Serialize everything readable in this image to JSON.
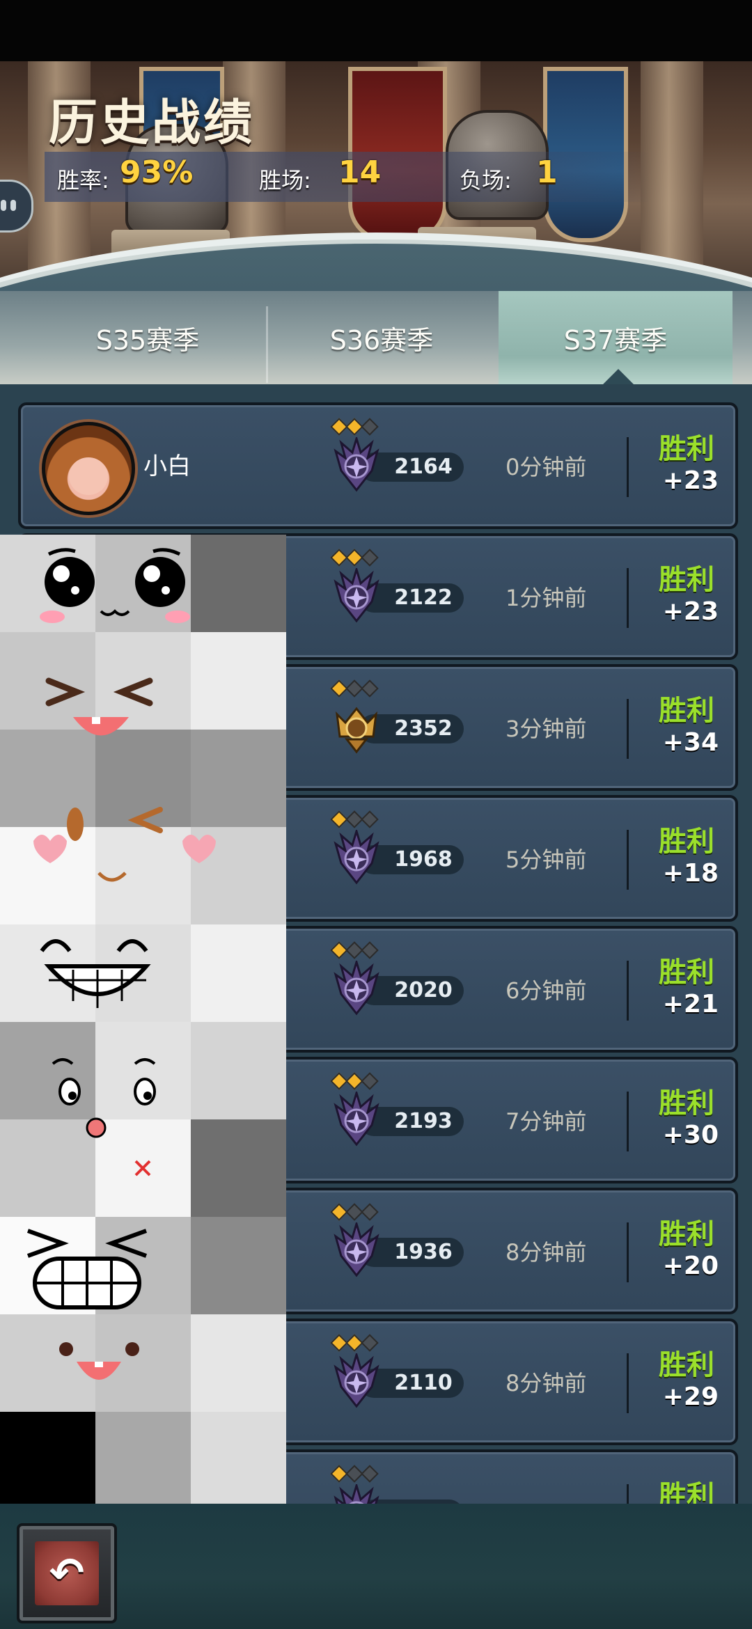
{
  "header": {
    "title": "历史战绩",
    "win_rate_label": "胜率:",
    "win_rate_value": "93%",
    "wins_label": "胜场:",
    "wins_value": "14",
    "losses_label": "负场:",
    "losses_value": "1"
  },
  "tabs": [
    {
      "label": "S35赛季",
      "active": false
    },
    {
      "label": "S36赛季",
      "active": false
    },
    {
      "label": "S37赛季",
      "active": true
    }
  ],
  "records": [
    {
      "name": "小白",
      "stars_lit": 2,
      "rank_badge": "purple-shield-icon",
      "score": "2164",
      "time": "0分钟前",
      "result": "胜利",
      "points": "+23"
    },
    {
      "name": "",
      "stars_lit": 2,
      "rank_badge": "purple-shield-icon",
      "score": "2122",
      "time": "1分钟前",
      "result": "胜利",
      "points": "+23"
    },
    {
      "name": "",
      "stars_lit": 1,
      "rank_badge": "gold-crown-icon",
      "score": "2352",
      "time": "3分钟前",
      "result": "胜利",
      "points": "+34"
    },
    {
      "name": "",
      "stars_lit": 1,
      "rank_badge": "purple-shield-icon",
      "score": "1968",
      "time": "5分钟前",
      "result": "胜利",
      "points": "+18"
    },
    {
      "name": "",
      "stars_lit": 1,
      "rank_badge": "purple-shield-icon",
      "score": "2020",
      "time": "6分钟前",
      "result": "胜利",
      "points": "+21"
    },
    {
      "name": "",
      "stars_lit": 2,
      "rank_badge": "purple-shield-icon",
      "score": "2193",
      "time": "7分钟前",
      "result": "胜利",
      "points": "+30"
    },
    {
      "name": "",
      "stars_lit": 1,
      "rank_badge": "purple-shield-icon",
      "score": "1936",
      "time": "8分钟前",
      "result": "胜利",
      "points": "+20"
    },
    {
      "name": "",
      "stars_lit": 2,
      "rank_badge": "purple-shield-icon",
      "score": "2110",
      "time": "8分钟前",
      "result": "胜利",
      "points": "+29"
    },
    {
      "name": "",
      "stars_lit": 1,
      "rank_badge": "purple-shield-icon",
      "score": "",
      "time": "",
      "result": "胜利",
      "points": ""
    }
  ],
  "footer": {
    "back_icon": "return-arrow-icon"
  },
  "colors": {
    "win_green": "#9be02b",
    "stat_yellow": "#ffd340",
    "card_bg": "#3b5066"
  }
}
